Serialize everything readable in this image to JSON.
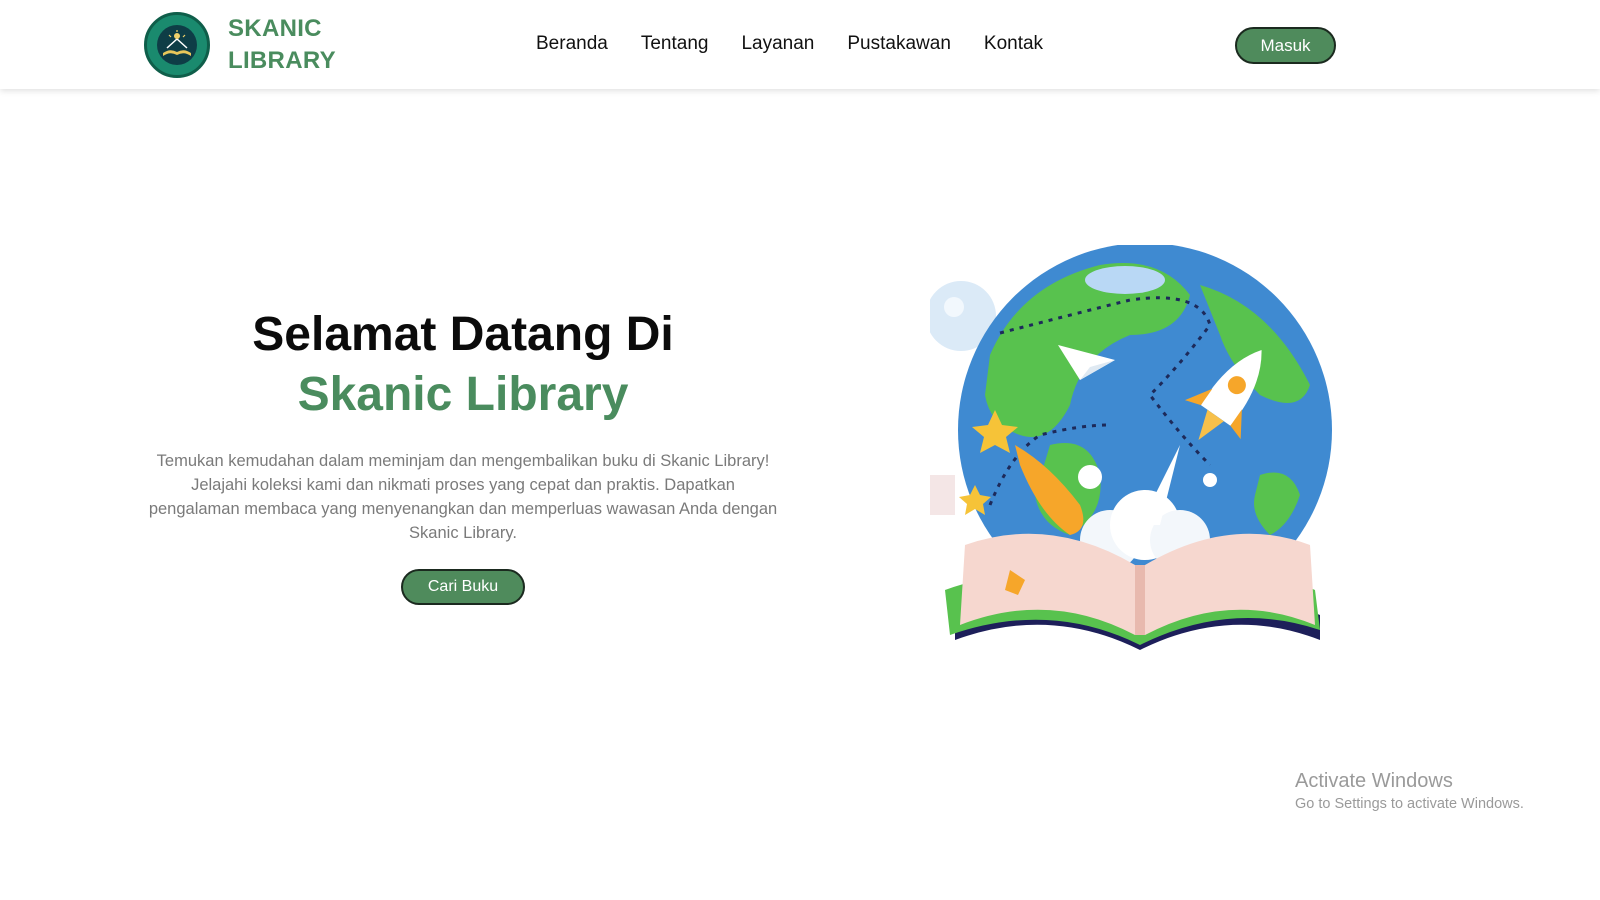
{
  "brand": {
    "line1": "SKANIC",
    "line2": "LIBRARY",
    "logo_icon": "library-logo-icon",
    "logo_text_top": "SKANIC LIBRARY",
    "logo_text_bottom": "SMKN 1 CIOMAS"
  },
  "nav": {
    "items": [
      {
        "label": "Beranda"
      },
      {
        "label": "Tentang"
      },
      {
        "label": "Layanan"
      },
      {
        "label": "Pustakawan"
      },
      {
        "label": "Kontak"
      }
    ],
    "login_label": "Masuk"
  },
  "hero": {
    "title_line1": "Selamat Datang Di",
    "title_line2": "Skanic Library",
    "description": "Temukan kemudahan dalam meminjam dan mengembalikan buku di Skanic Library! Jelajahi koleksi kami dan nikmati proses yang cepat dan praktis. Dapatkan pengalaman membaca yang menyenangkan dan memperluas wawasan Anda dengan Skanic Library.",
    "cta_label": "Cari Buku",
    "illustration_icon": "globe-book-rocket-illustration"
  },
  "watermark": {
    "title": "Activate Windows",
    "subtitle": "Go to Settings to activate Windows."
  },
  "colors": {
    "accent": "#4a8c5e",
    "button": "#4f8b5c",
    "text": "#0b0b0b",
    "muted": "#7a7a7a"
  }
}
